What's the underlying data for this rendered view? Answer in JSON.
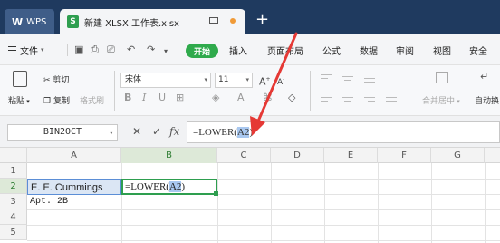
{
  "tabs": {
    "app_label": "WPS",
    "file_label": "新建 XLSX 工作表.xlsx",
    "s_glyph": "S"
  },
  "menu": {
    "file": "文件",
    "start": "开始",
    "items": [
      "插入",
      "页面布局",
      "公式",
      "数据",
      "审阅",
      "视图",
      "安全"
    ]
  },
  "ribbon": {
    "paste": "粘贴",
    "cut": "剪切",
    "copy": "复制",
    "format_painter": "格式刷",
    "font_name": "宋体",
    "font_size": "11",
    "merge_center": "合并居中",
    "auto_wrap": "自动换"
  },
  "formula_bar": {
    "name_box": "BIN2OCT",
    "cancel": "✕",
    "confirm": "✓",
    "fx": "fx",
    "formula_prefix": "=LOWER(",
    "formula_ref": "A2",
    "formula_suffix": ")"
  },
  "columns": [
    "A",
    "B",
    "C",
    "D",
    "E",
    "F",
    "G"
  ],
  "rows": [
    "1",
    "2",
    "3",
    "4",
    "5"
  ],
  "cells": {
    "a2": "E. E. Cummings",
    "b2_prefix": "=LOWER(",
    "b2_ref": "A2",
    "b2_suffix": ")",
    "a3": "Apt. 2B"
  },
  "colors": {
    "tabbar": "#1f3a5f",
    "accent_green": "#2faa4c",
    "selection_border": "#2e9e4f",
    "reference_highlight": "#a9c8f0",
    "annotation_arrow": "#e53935"
  }
}
